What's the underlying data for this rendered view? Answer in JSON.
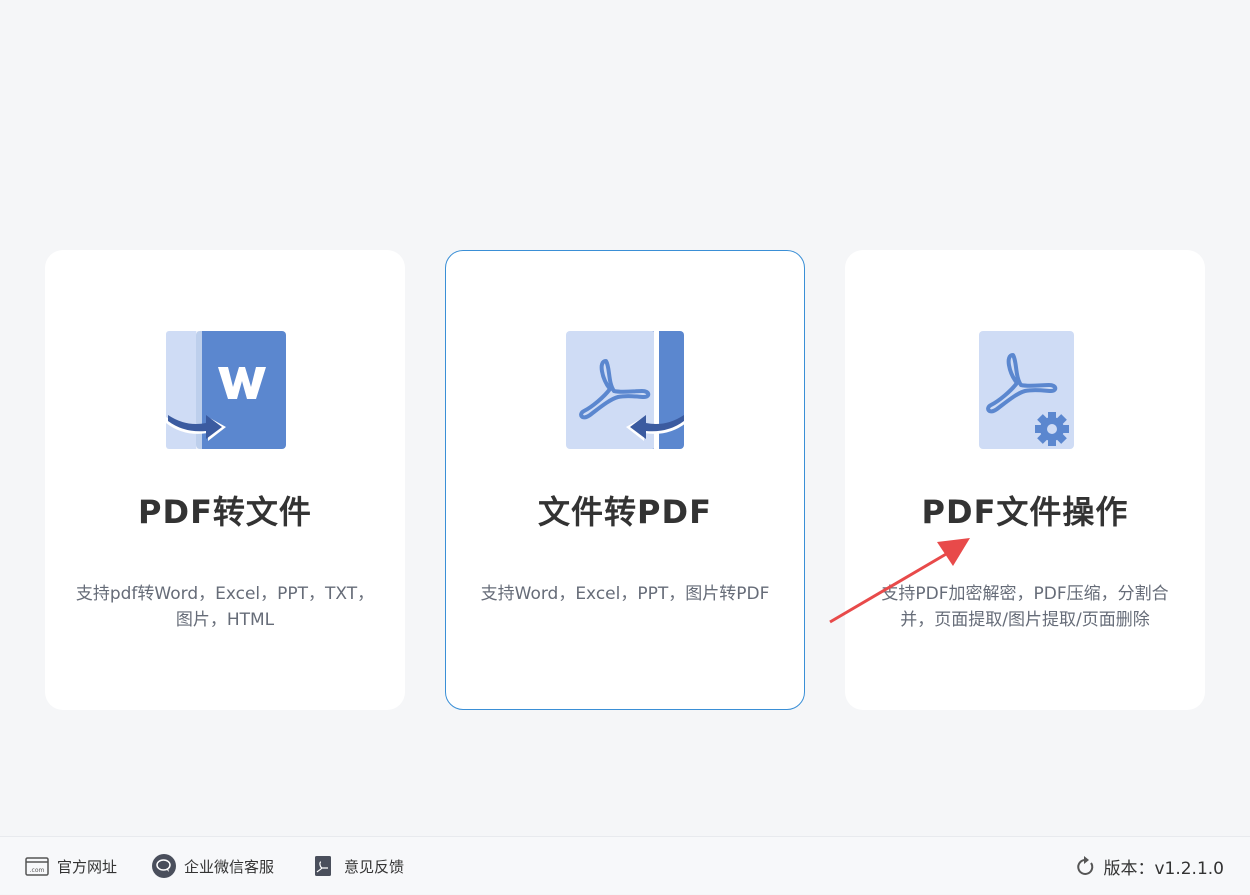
{
  "cards": [
    {
      "title": "PDF转文件",
      "desc": "支持pdf转Word，Excel，PPT，TXT，图片，HTML",
      "icon": "pdf-to-word-icon"
    },
    {
      "title": "文件转PDF",
      "desc": "支持Word，Excel，PPT，图片转PDF",
      "icon": "file-to-pdf-icon"
    },
    {
      "title": "PDF文件操作",
      "desc": "支持PDF加密解密，PDF压缩，分割合并，页面提取/图片提取/页面删除",
      "icon": "pdf-settings-icon"
    }
  ],
  "footer": {
    "website": "官方网址",
    "wechat": "企业微信客服",
    "feedback": "意见反馈",
    "version": "版本：v1.2.1.0"
  },
  "colors": {
    "accent": "#3a8fd6",
    "icon_dark": "#5b87cf",
    "icon_light": "#cfdcf5",
    "annotation_arrow": "#e84a4a"
  }
}
